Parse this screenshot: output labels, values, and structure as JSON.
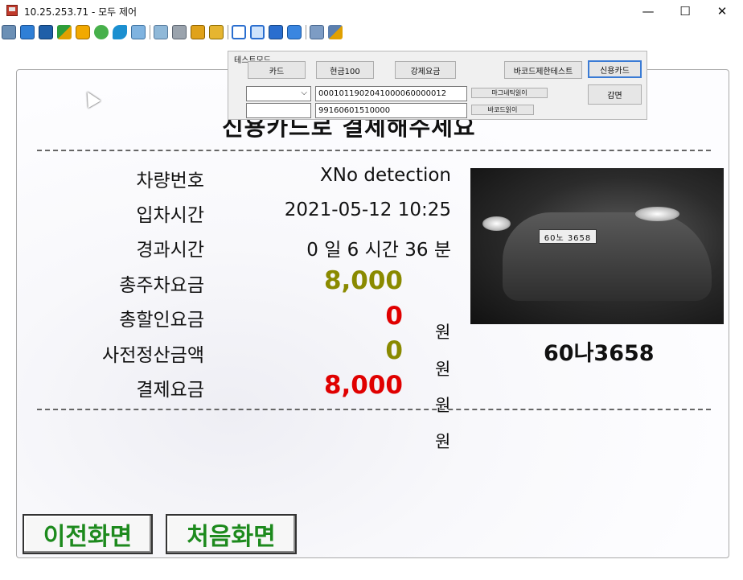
{
  "window": {
    "title": "10.25.253.71 - 모두 제어",
    "minimize_glyph": "—",
    "maximize_glyph": "☐",
    "close_glyph": "✕"
  },
  "toolbar": {
    "icons": [
      "monitor-icon",
      "screen-icon",
      "terminal-icon",
      "transfer-icon",
      "record-icon",
      "chat-icon",
      "phone-icon",
      "message-icon",
      "upload-icon",
      "network-icon",
      "lock-icon",
      "unlock-icon",
      "window-icon",
      "fit-icon",
      "fullscreen-icon",
      "zoom-icon",
      "copy-icon",
      "tools-icon"
    ]
  },
  "screen": {
    "headline": "신용카드로 결제해주세요",
    "labels": {
      "car_number": "차량번호",
      "entry_time": "입차시간",
      "elapsed_time": "경과시간",
      "total_parking_fee": "총주차요금",
      "total_discount": "총할인요금",
      "prepaid_amount": "사전정산금액",
      "payment_fee": "결제요금"
    },
    "values": {
      "car_number": "XNo detection",
      "entry_time": "2021-05-12 10:25",
      "elapsed_time": "0 일 6 시간 36 분",
      "total_parking_fee": "8,000",
      "total_discount": "0",
      "prepaid_amount": "0",
      "payment_fee": "8,000"
    },
    "currency_unit": "원",
    "plate_on_car": "60노 3658",
    "plate_recognized": "60나3658",
    "buttons": {
      "previous": "이전화면",
      "home": "처음화면"
    },
    "colors": {
      "total_fee": "#8a8a00",
      "discount": "#e00000",
      "prepaid": "#8a8a00",
      "payment": "#e00000",
      "nav_text": "#1d8a1d"
    }
  },
  "test_panel": {
    "title": "테스트모드",
    "buttons": {
      "card": "카드",
      "cash100": "현금100",
      "force_fee": "강제요금",
      "barcode_limit_test": "바코드제한테스트",
      "credit_card": "신용카드",
      "reduction": "감면",
      "card_add_read": "마그네틱읽이",
      "barcode_read": "바코드읽이"
    },
    "select_value": "",
    "card_number": "0001011902041000060000012",
    "barcode_number": "99160601510000",
    "extra_input": ""
  }
}
